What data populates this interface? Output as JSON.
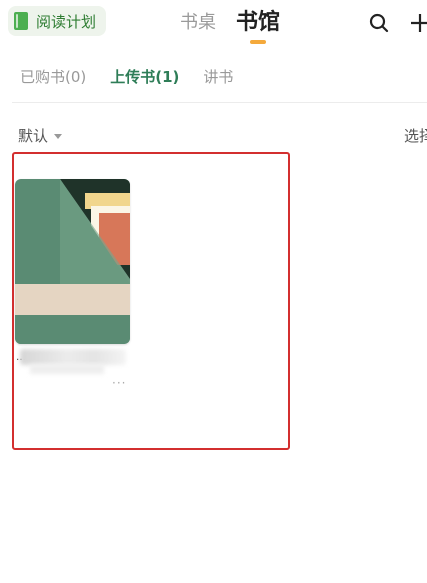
{
  "header": {
    "reading_plan": "阅读计划",
    "tabs": [
      {
        "label": "书桌",
        "active": false
      },
      {
        "label": "书馆",
        "active": true
      }
    ],
    "icons": [
      "book-icon",
      "search-icon",
      "plus-icon"
    ]
  },
  "sub_tabs": [
    {
      "label": "已购书(0)",
      "active": false
    },
    {
      "label": "上传书(1)",
      "active": true
    },
    {
      "label": "讲书",
      "active": false
    }
  ],
  "toolbar": {
    "sort_label": "默认",
    "select_label": "选择"
  },
  "book": {
    "more_label": "···",
    "title_mark": "…"
  },
  "colors": {
    "accent_green": "#2e7d57",
    "indicator_orange": "#f4a93b",
    "highlight_red": "#d32f2f",
    "cover_green": "#5a8b73"
  }
}
